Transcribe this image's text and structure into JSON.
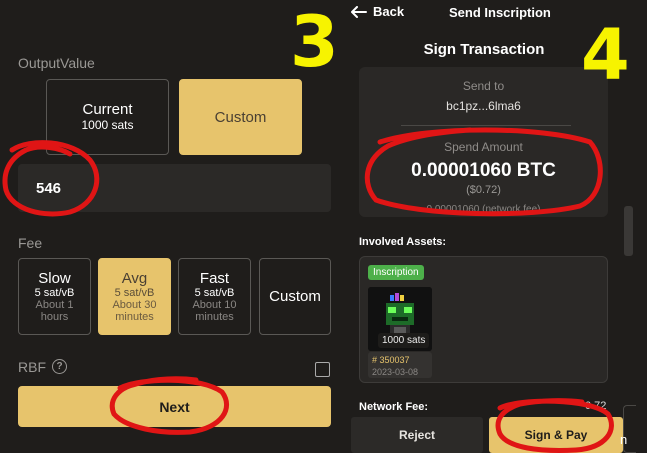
{
  "left": {
    "output_label": "OutputValue",
    "current": {
      "title": "Current",
      "value": "1000 sats"
    },
    "custom_label": "Custom",
    "output_input_value": "546",
    "fee_label": "Fee",
    "fees": [
      {
        "title": "Slow",
        "rate": "5 sat/vB",
        "eta1": "About 1",
        "eta2": "hours"
      },
      {
        "title": "Avg",
        "rate": "5 sat/vB",
        "eta1": "About 30",
        "eta2": "minutes"
      },
      {
        "title": "Fast",
        "rate": "5 sat/vB",
        "eta1": "About 10",
        "eta2": "minutes"
      }
    ],
    "fee_custom_label": "Custom",
    "rbf_label": "RBF",
    "help_glyph": "?",
    "next_label": "Next",
    "step_number": "3"
  },
  "right": {
    "back_label": "Back",
    "header_title": "Send Inscription",
    "sign_title": "Sign Transaction",
    "send_to_label": "Send to",
    "send_to_address": "bc1pz...6lma6",
    "spend_amount_label": "Spend Amount",
    "spend_amount": "0.00001060 BTC",
    "spend_usd": "($0.72)",
    "network_fee_line": "0.00001060 (network fee)",
    "involved_assets_label": "Involved Assets:",
    "inscription_badge": "Inscription",
    "inscription_sats": "1000 sats",
    "inscription_number": "# 350037",
    "inscription_date": "2023-03-08",
    "network_fee_label": "Network Fee:",
    "network_fee_value": "0.72",
    "reject_label": "Reject",
    "sign_pay_label": "Sign & Pay",
    "tail_char": "n",
    "step_number": "4"
  },
  "colors": {
    "gold": "#e7c46c",
    "background": "#1f1d1b",
    "annotation_red": "#e01515",
    "annotation_yellow": "#f7f300",
    "badge_green": "#4db04a"
  },
  "icons": [
    "back-arrow-icon",
    "help-icon",
    "checkbox-icon"
  ]
}
